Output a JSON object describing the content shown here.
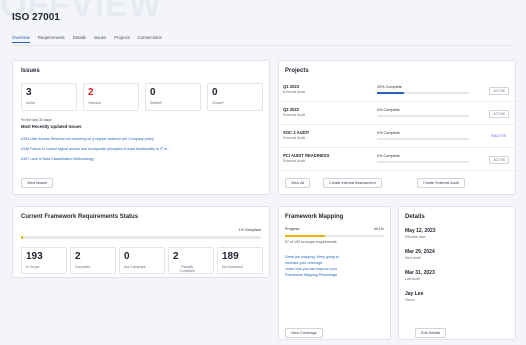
{
  "banner": "OFFVIEW",
  "page_title": "ISO 27001",
  "tabs": [
    "Overview",
    "Requirements",
    "Details",
    "Issues",
    "Projects",
    "Connections"
  ],
  "issues": {
    "title": "Issues",
    "stats": [
      {
        "value": "3",
        "label": "Active",
        "color": "#1f2430"
      },
      {
        "value": "2",
        "label": "Overdue",
        "color": "#dc2626"
      },
      {
        "value": "0",
        "label": "Started*",
        "color": "#1f2430"
      },
      {
        "value": "0",
        "label": "Closed*",
        "color": "#1f2430"
      }
    ],
    "footnote": "*In the last 30 days",
    "recent_heading": "Most Recently Updated Issues",
    "recent": [
      "#393 User Access Reviews not occurring on a regular cadence per Company policy",
      "#348 Failure to control logical access and incorporate principles of least functionality to IT re...",
      "#357 Lack of Data Classification Methodology"
    ],
    "view_button": "View Issues"
  },
  "projects": {
    "title": "Projects",
    "rows": [
      {
        "name": "Q1 2023",
        "sub": "External Audit",
        "pct": "29% Complete",
        "fill": 0.29,
        "status": "ACTIVE"
      },
      {
        "name": "Q2 2022",
        "sub": "External Audit",
        "pct": "0% Complete",
        "fill": 0.0,
        "status": "ACTIVE"
      },
      {
        "name": "SOC 2 AUDIT",
        "sub": "External Audit",
        "pct": "0% Complete",
        "fill": 0.0,
        "status": "INACTIVE"
      },
      {
        "name": "PCI AUDIT READINESS",
        "sub": "External Audit",
        "pct": "0% Complete",
        "fill": 0.0,
        "status": "ACTIVE"
      }
    ],
    "buttons": {
      "view_all": "View All",
      "create_internal": "Create Internal Assessment",
      "create_external": "Create External Audit"
    }
  },
  "framework": {
    "title": "Current Framework Requirements Status",
    "compliant_label": "1% Compliant",
    "compliant_fill": 0.01,
    "stats": [
      {
        "value": "193",
        "label": "In Scope"
      },
      {
        "value": "2",
        "label": "Compliant"
      },
      {
        "value": "0",
        "label": "Not Compliant"
      },
      {
        "value": "2",
        "label": "Partially Compliant"
      },
      {
        "value": "189",
        "label": "Not Assessed"
      }
    ]
  },
  "mapping": {
    "title": "Framework Mapping",
    "progress_label": "Progress",
    "progress_pct": "40.1%",
    "progress_fill": 0.401,
    "progress_sub": "97 of 193 in-scope requirements",
    "text_lines": [
      "Great job mapping. Keep going to",
      "increase your coverage."
    ],
    "link_lines": [
      "Learn how you can improve your",
      "Framework Mapping Percentage"
    ],
    "button": "View Coverage"
  },
  "details": {
    "title": "Details",
    "items": [
      {
        "date": "May 12, 2023",
        "label": "Effective date"
      },
      {
        "date": "Mar 29, 2024",
        "label": "Next Audit"
      },
      {
        "date": "Mar 31, 2023",
        "label": "Last Audit"
      },
      {
        "date": "Jay Lee",
        "label": "Owner"
      }
    ],
    "button": "Edit Details"
  },
  "colors": {
    "accent": "#2563b8",
    "danger": "#dc2626",
    "inactive": "#8b5cf6",
    "progress_yellow": "#eab308"
  }
}
